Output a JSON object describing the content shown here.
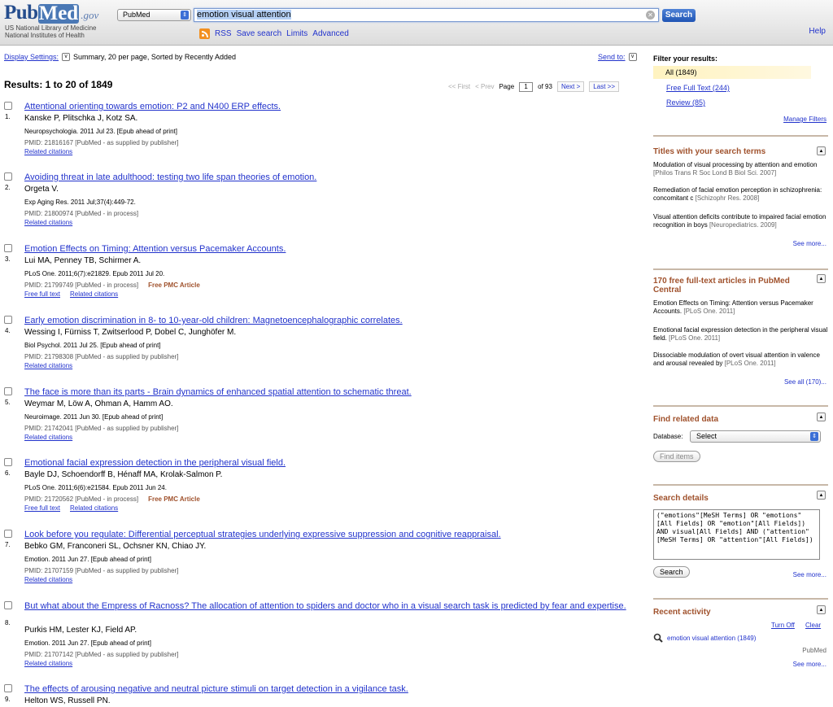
{
  "header": {
    "logo_pub": "Pub",
    "logo_med": "Med",
    "logo_gov": ".gov",
    "nlm_line1": "US National Library of Medicine",
    "nlm_line2": "National Institutes of Health",
    "db_value": "PubMed",
    "search_value": "emotion visual attention",
    "search_button": "Search",
    "links": [
      "RSS",
      "Save search",
      "Limits",
      "Advanced"
    ],
    "help": "Help"
  },
  "bar": {
    "display_settings_label": "Display Settings:",
    "display_settings_value": "Summary, 20 per page, Sorted by Recently Added",
    "send_to": "Send to:",
    "results_title": "Results: 1 to 20 of 1849",
    "pager": {
      "first": "<< First",
      "prev": "< Prev",
      "page_label": "Page",
      "page": "1",
      "of": "of 93",
      "next": "Next >",
      "last": "Last >>"
    }
  },
  "results": [
    {
      "num": "1.",
      "title": "Attentional orienting towards emotion: P2 and N400 ERP effects.",
      "authors": "Kanske P, Plitschka J, Kotz SA.",
      "journal": "Neuropsychologia. 2011 Jul 23. [Epub ahead of print]",
      "pmid": "PMID: 21816167 [PubMed - as supplied by publisher]",
      "pmc": "",
      "links": [
        "Related citations"
      ]
    },
    {
      "num": "2.",
      "title": "Avoiding threat in late adulthood: testing two life span theories of emotion.",
      "authors": "Orgeta V.",
      "journal": "Exp Aging Res. 2011 Jul;37(4):449-72.",
      "pmid": "PMID: 21800974 [PubMed - in process]",
      "pmc": "",
      "links": [
        "Related citations"
      ]
    },
    {
      "num": "3.",
      "title": "Emotion Effects on Timing: Attention versus Pacemaker Accounts.",
      "authors": "Lui MA, Penney TB, Schirmer A.",
      "journal": "PLoS One. 2011;6(7):e21829. Epub 2011 Jul 20.",
      "pmid": "PMID: 21799749 [PubMed - in process]",
      "pmc": "Free PMC Article",
      "links": [
        "Free full text",
        "Related citations"
      ]
    },
    {
      "num": "4.",
      "title": "Early emotion discrimination in 8- to 10-year-old children: Magnetoencephalographic correlates.",
      "authors": "Wessing I, Fürniss T, Zwitserlood P, Dobel C, Junghöfer M.",
      "journal": "Biol Psychol. 2011 Jul 25. [Epub ahead of print]",
      "pmid": "PMID: 21798308 [PubMed - as supplied by publisher]",
      "pmc": "",
      "links": [
        "Related citations"
      ]
    },
    {
      "num": "5.",
      "title": "The face is more than its parts - Brain dynamics of enhanced spatial attention to schematic threat.",
      "authors": "Weymar M, Löw A, Ohman A, Hamm AO.",
      "journal": "Neuroimage. 2011 Jun 30. [Epub ahead of print]",
      "pmid": "PMID: 21742041 [PubMed - as supplied by publisher]",
      "pmc": "",
      "links": [
        "Related citations"
      ]
    },
    {
      "num": "6.",
      "title": "Emotional facial expression detection in the peripheral visual field.",
      "authors": "Bayle DJ, Schoendorff B, Hénaff MA, Krolak-Salmon P.",
      "journal": "PLoS One. 2011;6(6):e21584. Epub 2011 Jun 24.",
      "pmid": "PMID: 21720562 [PubMed - in process]",
      "pmc": "Free PMC Article",
      "links": [
        "Free full text",
        "Related citations"
      ]
    },
    {
      "num": "7.",
      "title": "Look before you regulate: Differential perceptual strategies underlying expressive suppression and cognitive reappraisal.",
      "authors": "Bebko GM, Franconeri SL, Ochsner KN, Chiao JY.",
      "journal": "Emotion. 2011 Jun 27. [Epub ahead of print]",
      "pmid": "PMID: 21707159 [PubMed - as supplied by publisher]",
      "pmc": "",
      "links": [
        "Related citations"
      ]
    },
    {
      "num": "8.",
      "title": "But what about the Empress of Racnoss? The allocation of attention to spiders and doctor who in a visual search task is predicted by fear and expertise.",
      "authors": "Purkis HM, Lester KJ, Field AP.",
      "journal": "Emotion. 2011 Jun 27. [Epub ahead of print]",
      "pmid": "PMID: 21707142 [PubMed - as supplied by publisher]",
      "pmc": "",
      "links": [
        "Related citations"
      ]
    },
    {
      "num": "9.",
      "title": "The effects of arousing negative and neutral picture stimuli on target detection in a vigilance task.",
      "authors": "Helton WS, Russell PN.",
      "journal": "",
      "pmid": "",
      "pmc": "",
      "links": []
    }
  ],
  "sidebar": {
    "filter_title": "Filter your results:",
    "filters": [
      "All (1849)",
      "Free Full Text (244)",
      "Review (85)"
    ],
    "manage_filters": "Manage Filters",
    "titles_head": "Titles with your search terms",
    "titles": [
      {
        "text": "Modulation of visual processing by attention and emotion",
        "journal": "[Philos Trans R Soc Lond B Biol Sci. 2007]"
      },
      {
        "text": "Remediation of facial emotion perception in schizophrenia: concomitant c",
        "journal": "[Schizophr Res. 2008]"
      },
      {
        "text": "Visual attention deficits contribute to impaired facial emotion recognition in boys",
        "journal": "[Neuropediatrics. 2009]"
      }
    ],
    "titles_more": "See more...",
    "free_head": "170 free full-text articles in PubMed Central",
    "free": [
      {
        "text": "Emotion Effects on Timing: Attention versus Pacemaker Accounts.",
        "journal": "[PLoS One. 2011]"
      },
      {
        "text": "Emotional facial expression detection in the peripheral visual field.",
        "journal": "[PLoS One. 2011]"
      },
      {
        "text": "Dissociable modulation of overt visual attention in valence and arousal revealed by",
        "journal": "[PLoS One. 2011]"
      }
    ],
    "free_more": "See all (170)...",
    "related_head": "Find related data",
    "database_label": "Database:",
    "database_value": "Select",
    "find_items": "Find items",
    "details_head": "Search details",
    "details_text": "(\"emotions\"[MeSH Terms] OR \"emotions\"[All Fields] OR \"emotion\"[All Fields]) AND visual[All Fields] AND (\"attention\"[MeSH Terms] OR \"attention\"[All Fields])",
    "details_search": "Search",
    "details_more": "See more...",
    "recent_head": "Recent activity",
    "turn_off": "Turn Off",
    "clear": "Clear",
    "recent_item": "emotion visual attention (1849)",
    "recent_db": "PubMed",
    "recent_more": "See more..."
  }
}
